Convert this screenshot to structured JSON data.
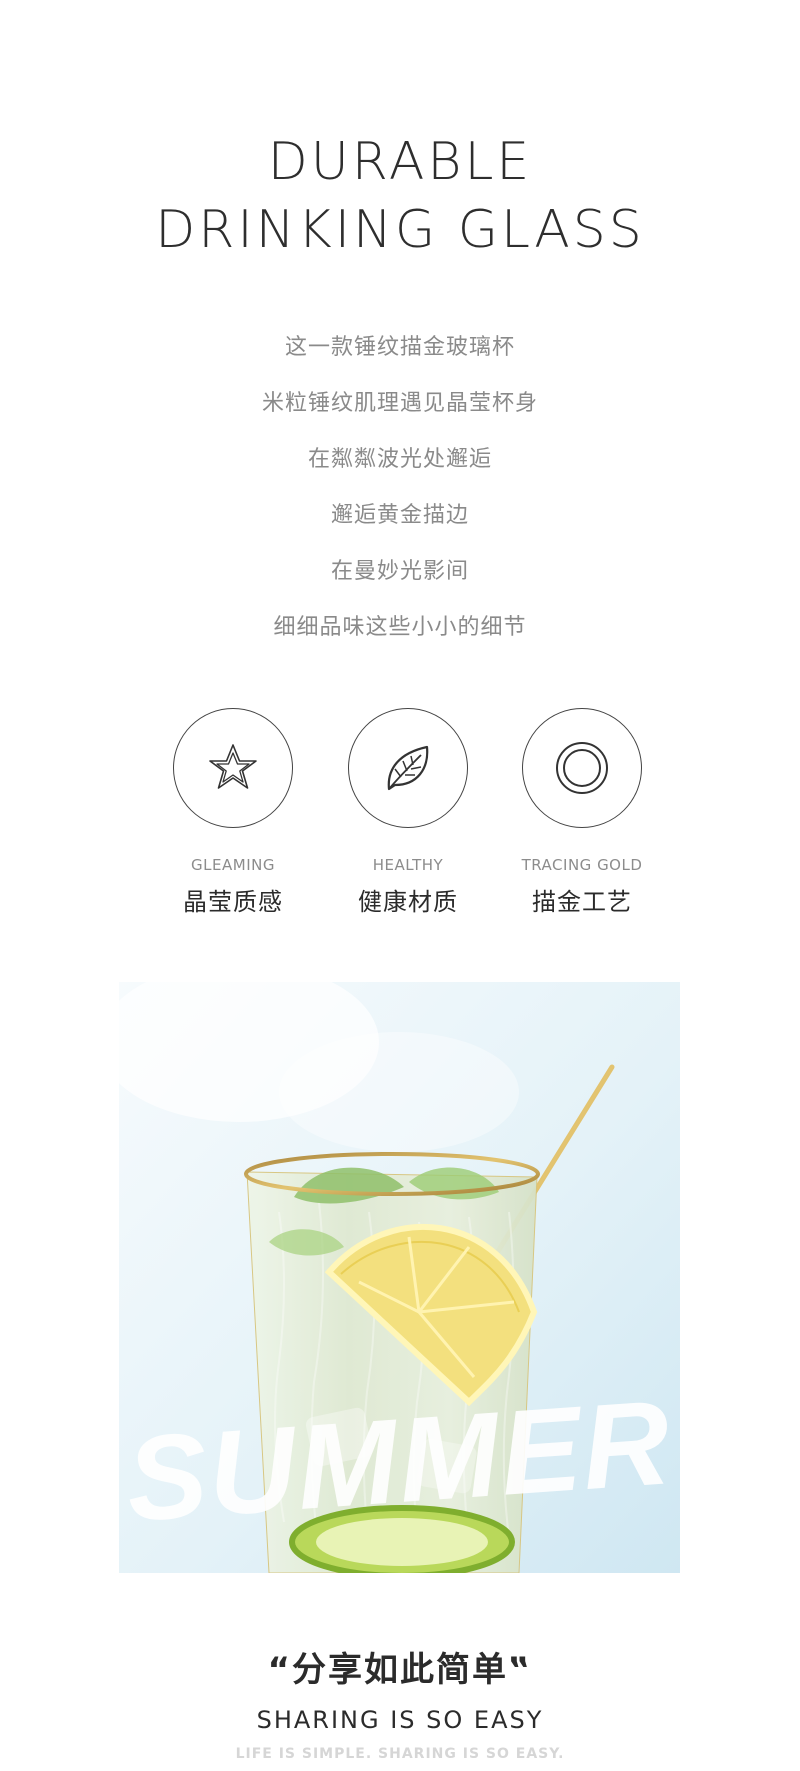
{
  "headline": {
    "line1": "DURABLE",
    "line2": "DRINKING GLASS"
  },
  "poem": [
    "这一款锤纹描金玻璃杯",
    "米粒锤纹肌理遇见晶莹杯身",
    "在粼粼波光处邂逅",
    "邂逅黄金描边",
    "在曼妙光影间",
    "细细品味这些小小的细节"
  ],
  "features": [
    {
      "icon": "star-icon",
      "en": "GLEAMING",
      "cn": "晶莹质感"
    },
    {
      "icon": "leaf-icon",
      "en": "HEALTHY",
      "cn": "健康材质"
    },
    {
      "icon": "ring-icon",
      "en": "TRACING GOLD",
      "cn": "描金工艺"
    }
  ],
  "photo": {
    "overlay_text": "SUMMER"
  },
  "footer": {
    "title": "“分享如此简单‟",
    "subtitle": "SHARING IS SO EASY",
    "tagline": "LIFE IS SIMPLE. SHARING IS SO EASY."
  },
  "colors": {
    "text_dark": "#2e2e2e",
    "text_gray": "#8a8a8a",
    "gold": "#c9a24a",
    "sky": "#dff0f8"
  }
}
